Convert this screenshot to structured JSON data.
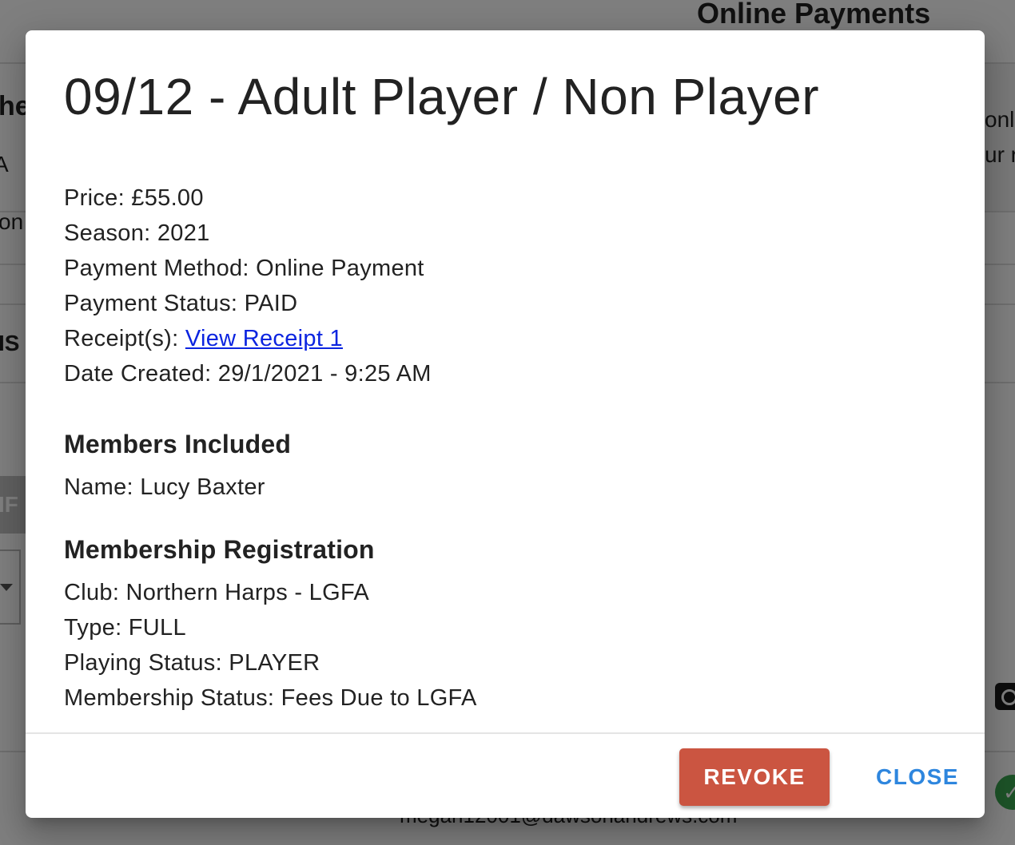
{
  "background": {
    "header_title": "Online Payments",
    "fragments": {
      "left_1": "he",
      "left_2": "A",
      "left_3": "on",
      "left_4": "IS",
      "left_5": "IF",
      "right_1": "onl",
      "right_2": "ur r",
      "email": "megan12001@dawsonandrews.com"
    }
  },
  "modal": {
    "title": "09/12 - Adult Player / Non Player",
    "details": {
      "price": "Price: £55.00",
      "season": "Season: 2021",
      "payment_method": "Payment Method: Online Payment",
      "payment_status": "Payment Status: PAID",
      "receipts_label": "Receipt(s): ",
      "receipt_link": "View Receipt 1",
      "date_created": "Date Created: 29/1/2021 - 9:25 AM"
    },
    "members_section": {
      "title": "Members Included",
      "name": "Name: Lucy Baxter"
    },
    "registration_section": {
      "title": "Membership Registration",
      "club": "Club: Northern Harps - LGFA",
      "type": "Type: FULL",
      "playing_status": "Playing Status: PLAYER",
      "membership_status": "Membership Status: Fees Due to LGFA"
    },
    "footer": {
      "revoke_label": "REVOKE",
      "close_label": "CLOSE"
    }
  },
  "colors": {
    "revoke_button": "#cb5541",
    "close_button_text": "#2e86de",
    "link": "#0b24e0"
  },
  "icons": {
    "camera": "camera-icon",
    "check": "check-circle-icon"
  }
}
